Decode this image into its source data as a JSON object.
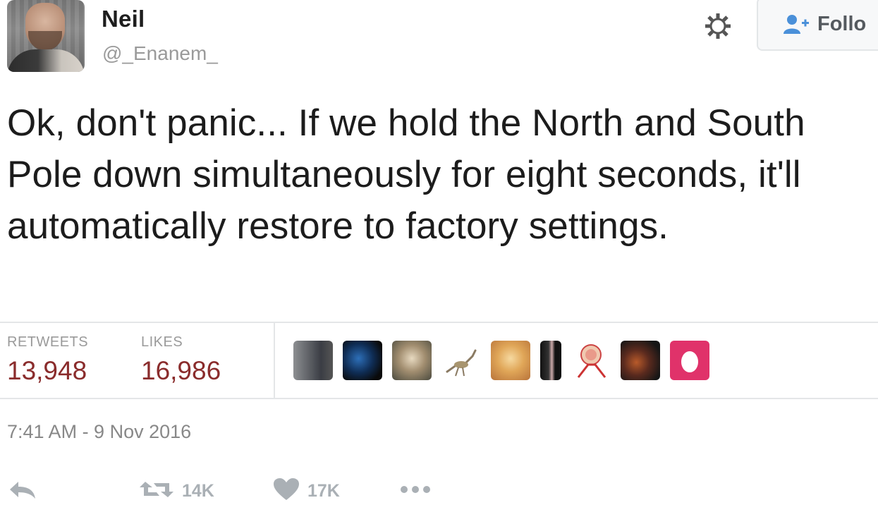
{
  "author": {
    "name": "Neil",
    "handle": "@_Enanem_"
  },
  "header": {
    "follow_label": "Follo"
  },
  "tweet": {
    "text": "Ok, don't panic... If we hold the North and South Pole down simultaneously for eight seconds, it'll automatically restore to factory settings.",
    "timestamp": "7:41 AM - 9 Nov 2016"
  },
  "stats": {
    "retweets_label": "RETWEETS",
    "retweets_value": "13,948",
    "likes_label": "LIKES",
    "likes_value": "16,986"
  },
  "actions": {
    "retweet_count": "14K",
    "like_count": "17K"
  },
  "icons": {
    "gear": "gear-icon",
    "follow": "add-user-icon",
    "reply": "reply-icon",
    "retweet": "retweet-icon",
    "like": "heart-icon",
    "more": "more-icon"
  },
  "colors": {
    "stat_value": "#8a2c2c",
    "muted": "#9a9a9a",
    "follow_icon": "#4a90d9"
  }
}
